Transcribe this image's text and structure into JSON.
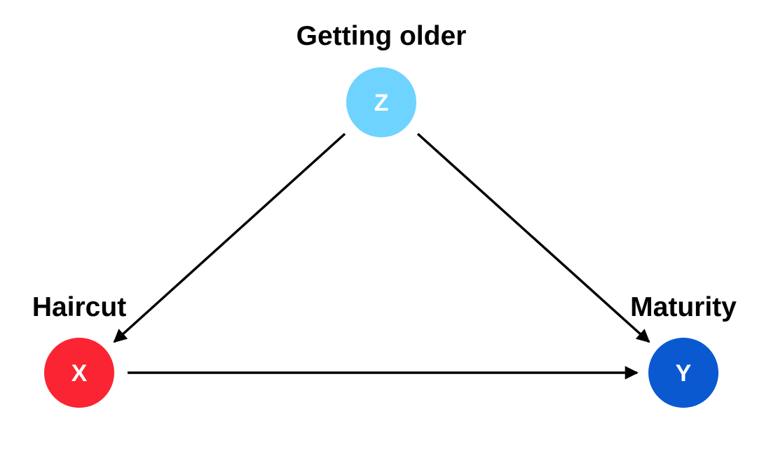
{
  "diagram": {
    "type": "directed-acyclic-graph",
    "nodes": {
      "z": {
        "letter": "Z",
        "title": "Getting older",
        "color": "#6ed3ff"
      },
      "x": {
        "letter": "X",
        "title": "Haircut",
        "color": "#fa2432"
      },
      "y": {
        "letter": "Y",
        "title": "Maturity",
        "color": "#0b59d1"
      }
    },
    "edges": [
      {
        "from": "Z",
        "to": "X"
      },
      {
        "from": "Z",
        "to": "Y"
      },
      {
        "from": "X",
        "to": "Y"
      }
    ],
    "edge_color": "#000000"
  }
}
